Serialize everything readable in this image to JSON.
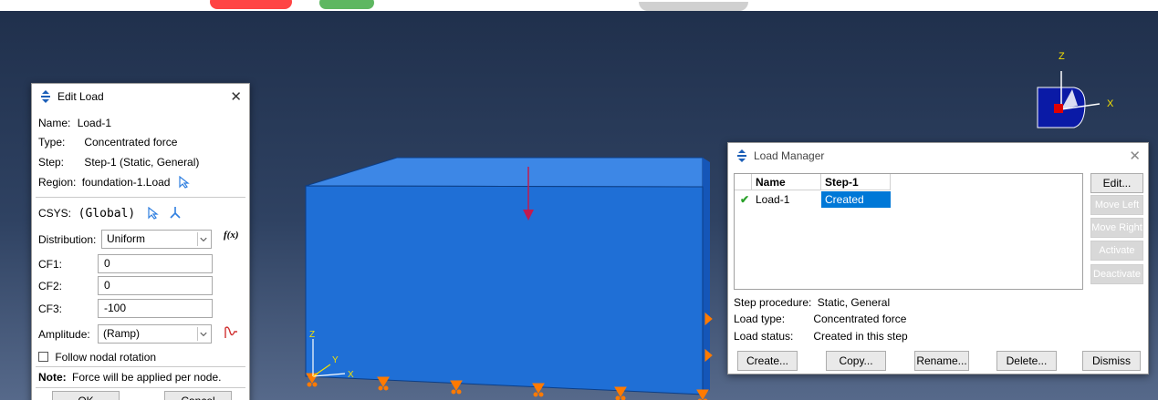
{
  "viewport": {
    "triad_labels": {
      "z": "Z",
      "x": "X"
    },
    "part_csys_labels": {
      "z": "Z",
      "y": "Y",
      "x": "X"
    },
    "colors": {
      "part_fill": "#1f6fd6",
      "load_arrow": "#c21a4e",
      "bc_symbol": "#ff7a00",
      "triad_label": "#f5e000"
    }
  },
  "edit_load": {
    "title": "Edit Load",
    "name_label": "Name:",
    "name_value": "Load-1",
    "type_label": "Type:",
    "type_value": "Concentrated force",
    "step_label": "Step:",
    "step_value": "Step-1 (Static, General)",
    "region_label": "Region:",
    "region_value": "foundation-1.Load",
    "csys_label": "CSYS:",
    "csys_value": "(Global)",
    "distribution_label": "Distribution:",
    "distribution_value": "Uniform",
    "fx_label": "f(x)",
    "cf1_label": "CF1:",
    "cf1_value": "0",
    "cf2_label": "CF2:",
    "cf2_value": "0",
    "cf3_label": "CF3:",
    "cf3_value": "-100",
    "amplitude_label": "Amplitude:",
    "amplitude_value": "(Ramp)",
    "follow_label": "Follow nodal rotation",
    "note_label": "Note:",
    "note_text": "Force will be applied per node.",
    "ok_label": "OK",
    "cancel_label": "Cancel"
  },
  "load_manager": {
    "title": "Load Manager",
    "columns": [
      "Name",
      "Step-1"
    ],
    "rows": [
      {
        "status_icon": "checkmark-icon",
        "name": "Load-1",
        "step1": "Created"
      }
    ],
    "side_buttons": [
      {
        "label": "Edit...",
        "enabled": true
      },
      {
        "label": "Move Left",
        "enabled": false
      },
      {
        "label": "Move Right",
        "enabled": false
      },
      {
        "label": "Activate",
        "enabled": false
      },
      {
        "label": "Deactivate",
        "enabled": false
      }
    ],
    "step_procedure_label": "Step procedure:",
    "step_procedure_value": "Static, General",
    "load_type_label": "Load type:",
    "load_type_value": "Concentrated force",
    "load_status_label": "Load status:",
    "load_status_value": "Created in this step",
    "bottom_buttons": [
      "Create...",
      "Copy...",
      "Rename...",
      "Delete...",
      "Dismiss"
    ],
    "accent": "#0078d7"
  }
}
